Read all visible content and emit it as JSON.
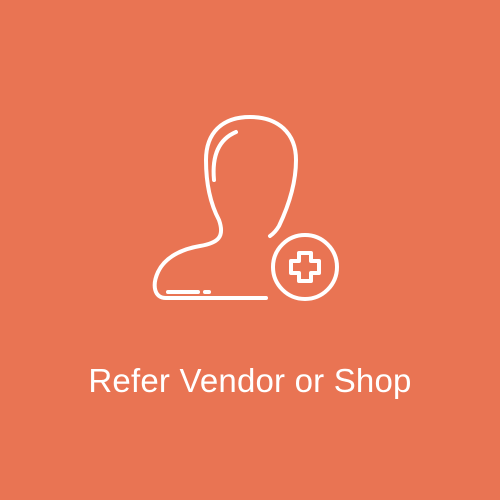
{
  "tile": {
    "label": "Refer Vendor or Shop",
    "icon": "user-add-icon",
    "background_color": "#e97453",
    "foreground_color": "#ffffff"
  }
}
